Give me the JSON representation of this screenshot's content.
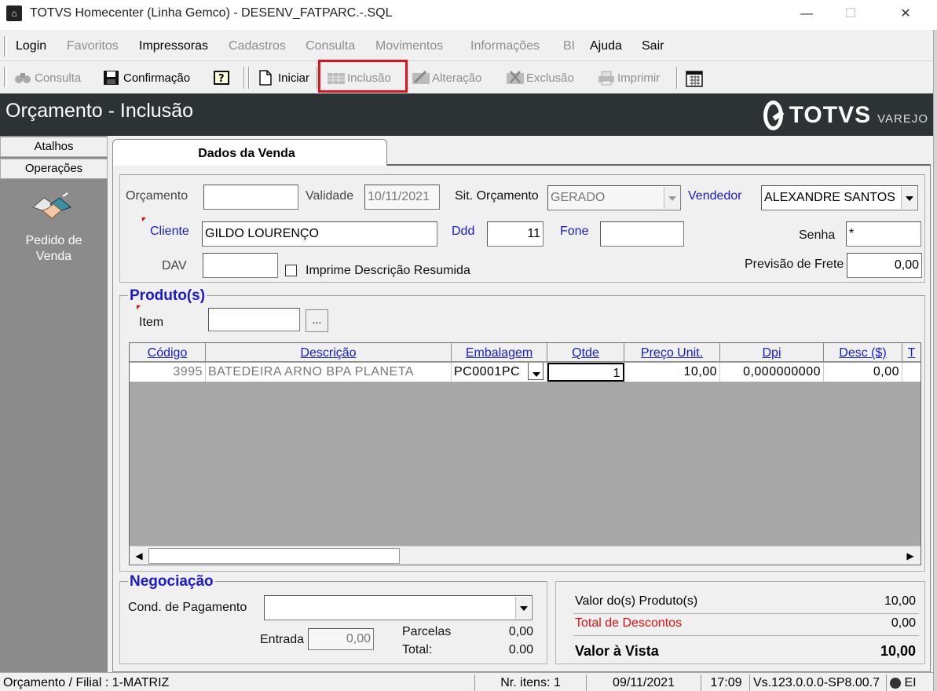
{
  "window": {
    "title": "TOTVS Homecenter (Linha Gemco) - DESENV_FATPARC.-.SQL",
    "minimize": "—",
    "maximize": "☐",
    "close": "✕"
  },
  "menu": {
    "items": [
      {
        "label": "Login",
        "enabled": true
      },
      {
        "label": "Favoritos",
        "enabled": false
      },
      {
        "label": "Impressoras",
        "enabled": true
      },
      {
        "label": "Cadastros",
        "enabled": false
      },
      {
        "label": "Consulta",
        "enabled": false
      },
      {
        "label": "Movimentos",
        "enabled": false
      },
      {
        "label": "Informações",
        "enabled": false
      },
      {
        "label": "BI",
        "enabled": false
      },
      {
        "label": "Ajuda",
        "enabled": true
      },
      {
        "label": "Sair",
        "enabled": true
      }
    ]
  },
  "toolbar": {
    "consulta": "Consulta",
    "confirmacao": "Confirmação",
    "iniciar": "Iniciar",
    "inclusao": "Inclusão",
    "alteracao": "Alteração",
    "exclusao": "Exclusão",
    "imprimir": "Imprimir",
    "highlight_color": "#e8101a"
  },
  "header": {
    "title": "Orçamento  - Inclusão",
    "logo_word": "TOTVS",
    "logo_sub": "VAREJO",
    "bg_color": "#2d3234"
  },
  "sidebar": {
    "atalhos": "Atalhos",
    "operacoes": "Operações",
    "pedido": "Pedido de Venda"
  },
  "tab": {
    "label": "Dados da Venda"
  },
  "form": {
    "orcamento_label": "Orçamento",
    "orcamento_value": "",
    "validade_label": "Validade",
    "validade_value": "10/11/2021",
    "sit_label": "Sit. Orçamento",
    "sit_value": "GERADO",
    "vendedor_label": "Vendedor",
    "vendedor_value": "ALEXANDRE SANTOS",
    "cliente_label": "Cliente",
    "cliente_value": "GILDO LOURENÇO",
    "ddd_label": "Ddd",
    "ddd_value": "11",
    "fone_label": "Fone",
    "fone_value": "",
    "senha_label": "Senha",
    "senha_value": "*",
    "dav_label": "DAV",
    "dav_value": "",
    "imprime_label": "Imprime Descrição Resumida",
    "frete_label": "Previsão de Frete",
    "frete_value": "0,00"
  },
  "produtos": {
    "title": "Produto(s)",
    "item_label": "Item",
    "item_value": "",
    "browse": "...",
    "columns": [
      "Código",
      "Descrição",
      "Embalagem",
      "Qtde",
      "Preço Unit.",
      "Dpi",
      "Desc ($)",
      "T"
    ],
    "rows": [
      {
        "codigo": "3995",
        "descricao": "BATEDEIRA ARNO BPA PLANETA",
        "embalagem": "PC0001PC",
        "qtde": "1",
        "preco": "10,00",
        "dpi": "0,000000000",
        "desc": "0,00"
      }
    ]
  },
  "negociacao": {
    "title": "Negociação",
    "cond_label": "Cond. de Pagamento",
    "cond_value": "",
    "entrada_label": "Entrada",
    "entrada_value": "0,00",
    "parcelas_label": "Parcelas",
    "parcelas_value": "0,00",
    "total_label": "Total:",
    "total_value": "0.00"
  },
  "totals": {
    "produtos_label": "Valor do(s) Produto(s)",
    "produtos_value": "10,00",
    "descontos_label": "Total de Descontos",
    "descontos_value": "0,00",
    "vista_label": "Valor à Vista",
    "vista_value": "10,00"
  },
  "status": {
    "filial": "Orçamento / Filial : 1-MATRIZ",
    "itens": "Nr. itens: 1",
    "date": "09/11/2021",
    "time": "17:09",
    "version": "Vs.123.0.0.0-SP8.00.7",
    "tail": "EI"
  }
}
